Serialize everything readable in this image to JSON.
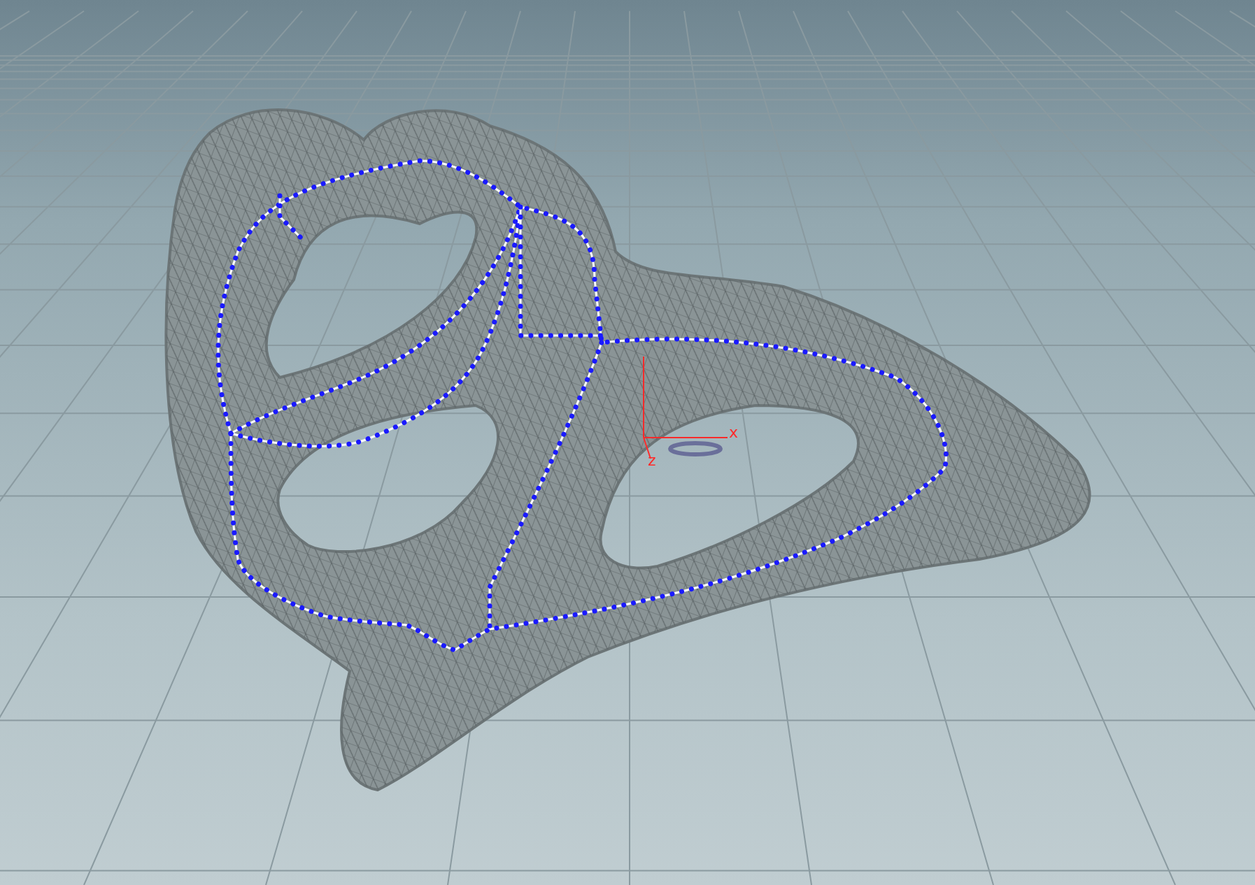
{
  "viewport": {
    "axes": [
      {
        "kind": "x",
        "label": "x"
      },
      {
        "kind": "z",
        "label": "z"
      }
    ]
  }
}
